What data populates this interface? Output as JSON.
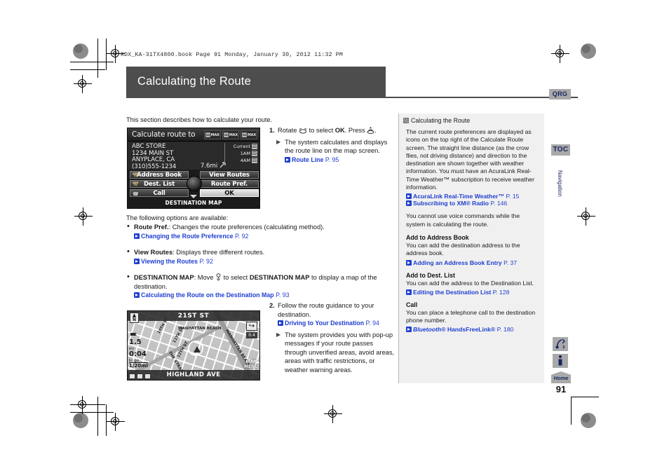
{
  "print_header": {
    "book_line": "RDX_KA-31TX4800.book  Page 91  Monday, January 30, 2012  11:32 PM"
  },
  "banner": {
    "title": "Calculating the Route"
  },
  "edge_tabs": {
    "qrg": "QRG",
    "toc": "TOC",
    "section_vertical": "Navigation",
    "voice_icon": "voice-command-icon",
    "info_icon": "info-icon",
    "home": "Home",
    "page_number": "91"
  },
  "main": {
    "intro": "This section describes how to calculate your route.",
    "following_label": "The following options are available:",
    "bullets": [
      {
        "term": "Route Pref.",
        "rest": ": Changes the route preferences (calculating method).",
        "xref": "Changing the Route Preference",
        "page": "P. 92"
      },
      {
        "term": "View Routes",
        "rest": ": Displays three different routes.",
        "xref": "Viewing the Routes",
        "page": "P. 92"
      },
      {
        "term": "DESTINATION MAP",
        "rest": ": Move   to select DESTINATION MAP to display a map of the destination.",
        "rest_a": ": Move ",
        "rest_b": " to select ",
        "rest_c": "DESTINATION MAP",
        "rest_d": " to display a map of the destination.",
        "xref": "Calculating the Route on the Destination Map",
        "page": "P. 93"
      }
    ],
    "steps": [
      {
        "num": "1.",
        "text_a": "Rotate ",
        "text_b": " to select ",
        "text_bold": "OK",
        "text_c": ". Press ",
        "text_d": ".",
        "sub": "The system calculates and displays the route line on the map screen.",
        "xref": "Route Line",
        "page": "P. 95"
      },
      {
        "num": "2.",
        "text": "Follow the route guidance to your destination.",
        "xref": "Driving to Your Destination",
        "page": "P. 94",
        "sub": "The system provides you with pop-up messages if your route passes through unverified areas, avoid areas, areas with traffic restrictions, or weather warning areas."
      }
    ]
  },
  "nav_screen": {
    "title": "Calculate route to",
    "pref_icons": [
      "MAX",
      "MAX",
      "MAX"
    ],
    "address": [
      "ABC STORE",
      "1234 MAIN ST",
      "ANYPLACE, CA",
      "(310)555-1234"
    ],
    "distance": "7.6mi",
    "weather_rows": [
      "Current",
      "1AM",
      "4AM"
    ],
    "buttons": [
      {
        "label": "Address Book",
        "badge": "ADD TO",
        "selected": false
      },
      {
        "label": "View Routes",
        "badge": "",
        "selected": false
      },
      {
        "label": "Dest. List",
        "badge": "ADD TO",
        "selected": false
      },
      {
        "label": "Route Pref.",
        "badge": "",
        "selected": false
      },
      {
        "label": "Call",
        "badge": "",
        "selected": false
      },
      {
        "label": "OK",
        "badge": "",
        "selected": true
      }
    ],
    "bottom_label": "DESTINATION MAP"
  },
  "map_screen": {
    "top_street": "21ST ST",
    "bottom_street": "HIGHLAND AVE",
    "compass": "N",
    "distance_value": "1.5",
    "distance_unit": "mi",
    "eta_value": "0:04",
    "eta_label": "to go",
    "scale": "1/20mi",
    "turn_distance": "0.4",
    "map_menu": "MAP MENU",
    "labels": [
      "MANHATTAN BEACH",
      "MANHATTAN BEACH",
      "10TH ST",
      "11TH ST",
      "12TH ST",
      "THE STRAND"
    ]
  },
  "sidebar": {
    "heading": "Calculating the Route",
    "paragraphs": [
      "The current route preferences are displayed as icons on the top right of the Calculate Route screen. The straight line distance (as the crow flies, not driving distance) and direction to the destination are shown together with weather information. You must have an AcuraLink Real-Time Weather™ subscription to receive weather information."
    ],
    "xrefs_top": [
      {
        "text": "AcuraLink Real-Time Weather™",
        "page": "P. 15"
      },
      {
        "text": "Subscribing to XM® Radio",
        "page": "P. 146"
      }
    ],
    "voice_note": "You cannot use voice commands while the system is calculating the route.",
    "sections": [
      {
        "title": "Add to Address Book",
        "body": "You can add the destination address to the address book.",
        "xref": "Adding an Address Book Entry",
        "page": "P. 37"
      },
      {
        "title": "Add to Dest. List",
        "body": "You can add the address to the Destination List.",
        "xref": "Editing the Destination List",
        "page": "P. 128"
      },
      {
        "title": "Call",
        "body": "You can place a telephone call to the destination phone number.",
        "xref": "Bluetooth® HandsFreeLink®",
        "xref_italic": "Bluetooth®",
        "xref_rest": " HandsFreeLink®",
        "page": "P. 180"
      }
    ]
  },
  "colors": {
    "banner_bg": "#4d4d4d",
    "xref_blue": "#1f3fd0",
    "tab_gray": "#a9a9a9",
    "tab_text": "#16255e",
    "sidebar_bg": "#f0f0f0"
  }
}
